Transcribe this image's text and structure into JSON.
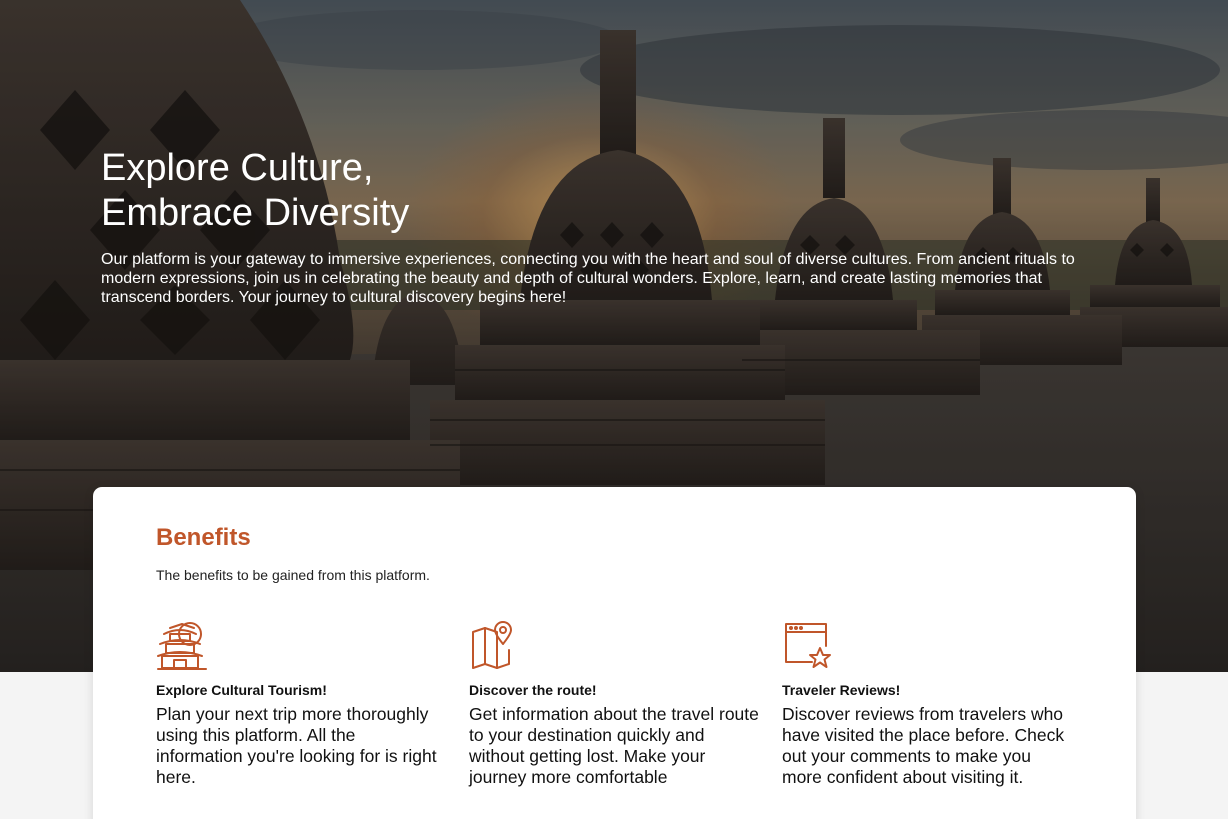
{
  "hero": {
    "title_line1": "Explore Culture,",
    "title_line2": "Embrace Diversity",
    "description": "Our platform is your gateway to immersive experiences, connecting you with the heart and soul of diverse cultures. From ancient rituals to modern expressions, join us in celebrating the beauty and depth of cultural wonders. Explore, learn, and create lasting memories that transcend borders. Your journey to cultural discovery begins here!"
  },
  "benefits": {
    "title": "Benefits",
    "subtitle": "The benefits to be gained from this platform.",
    "accent_color": "#c0562a",
    "items": [
      {
        "icon": "pagoda-icon",
        "title": "Explore Cultural Tourism!",
        "text": "Plan your next trip more thoroughly using this platform. All the information you're looking for is right here."
      },
      {
        "icon": "map-pin-icon",
        "title": "Discover the route!",
        "text": "Get information about the travel route to your destination quickly and without getting lost. Make your journey more comfortable"
      },
      {
        "icon": "review-star-icon",
        "title": "Traveler Reviews!",
        "text": "Discover reviews from travelers who have visited the place before. Check out your comments to make you more confident about visiting it."
      }
    ]
  }
}
